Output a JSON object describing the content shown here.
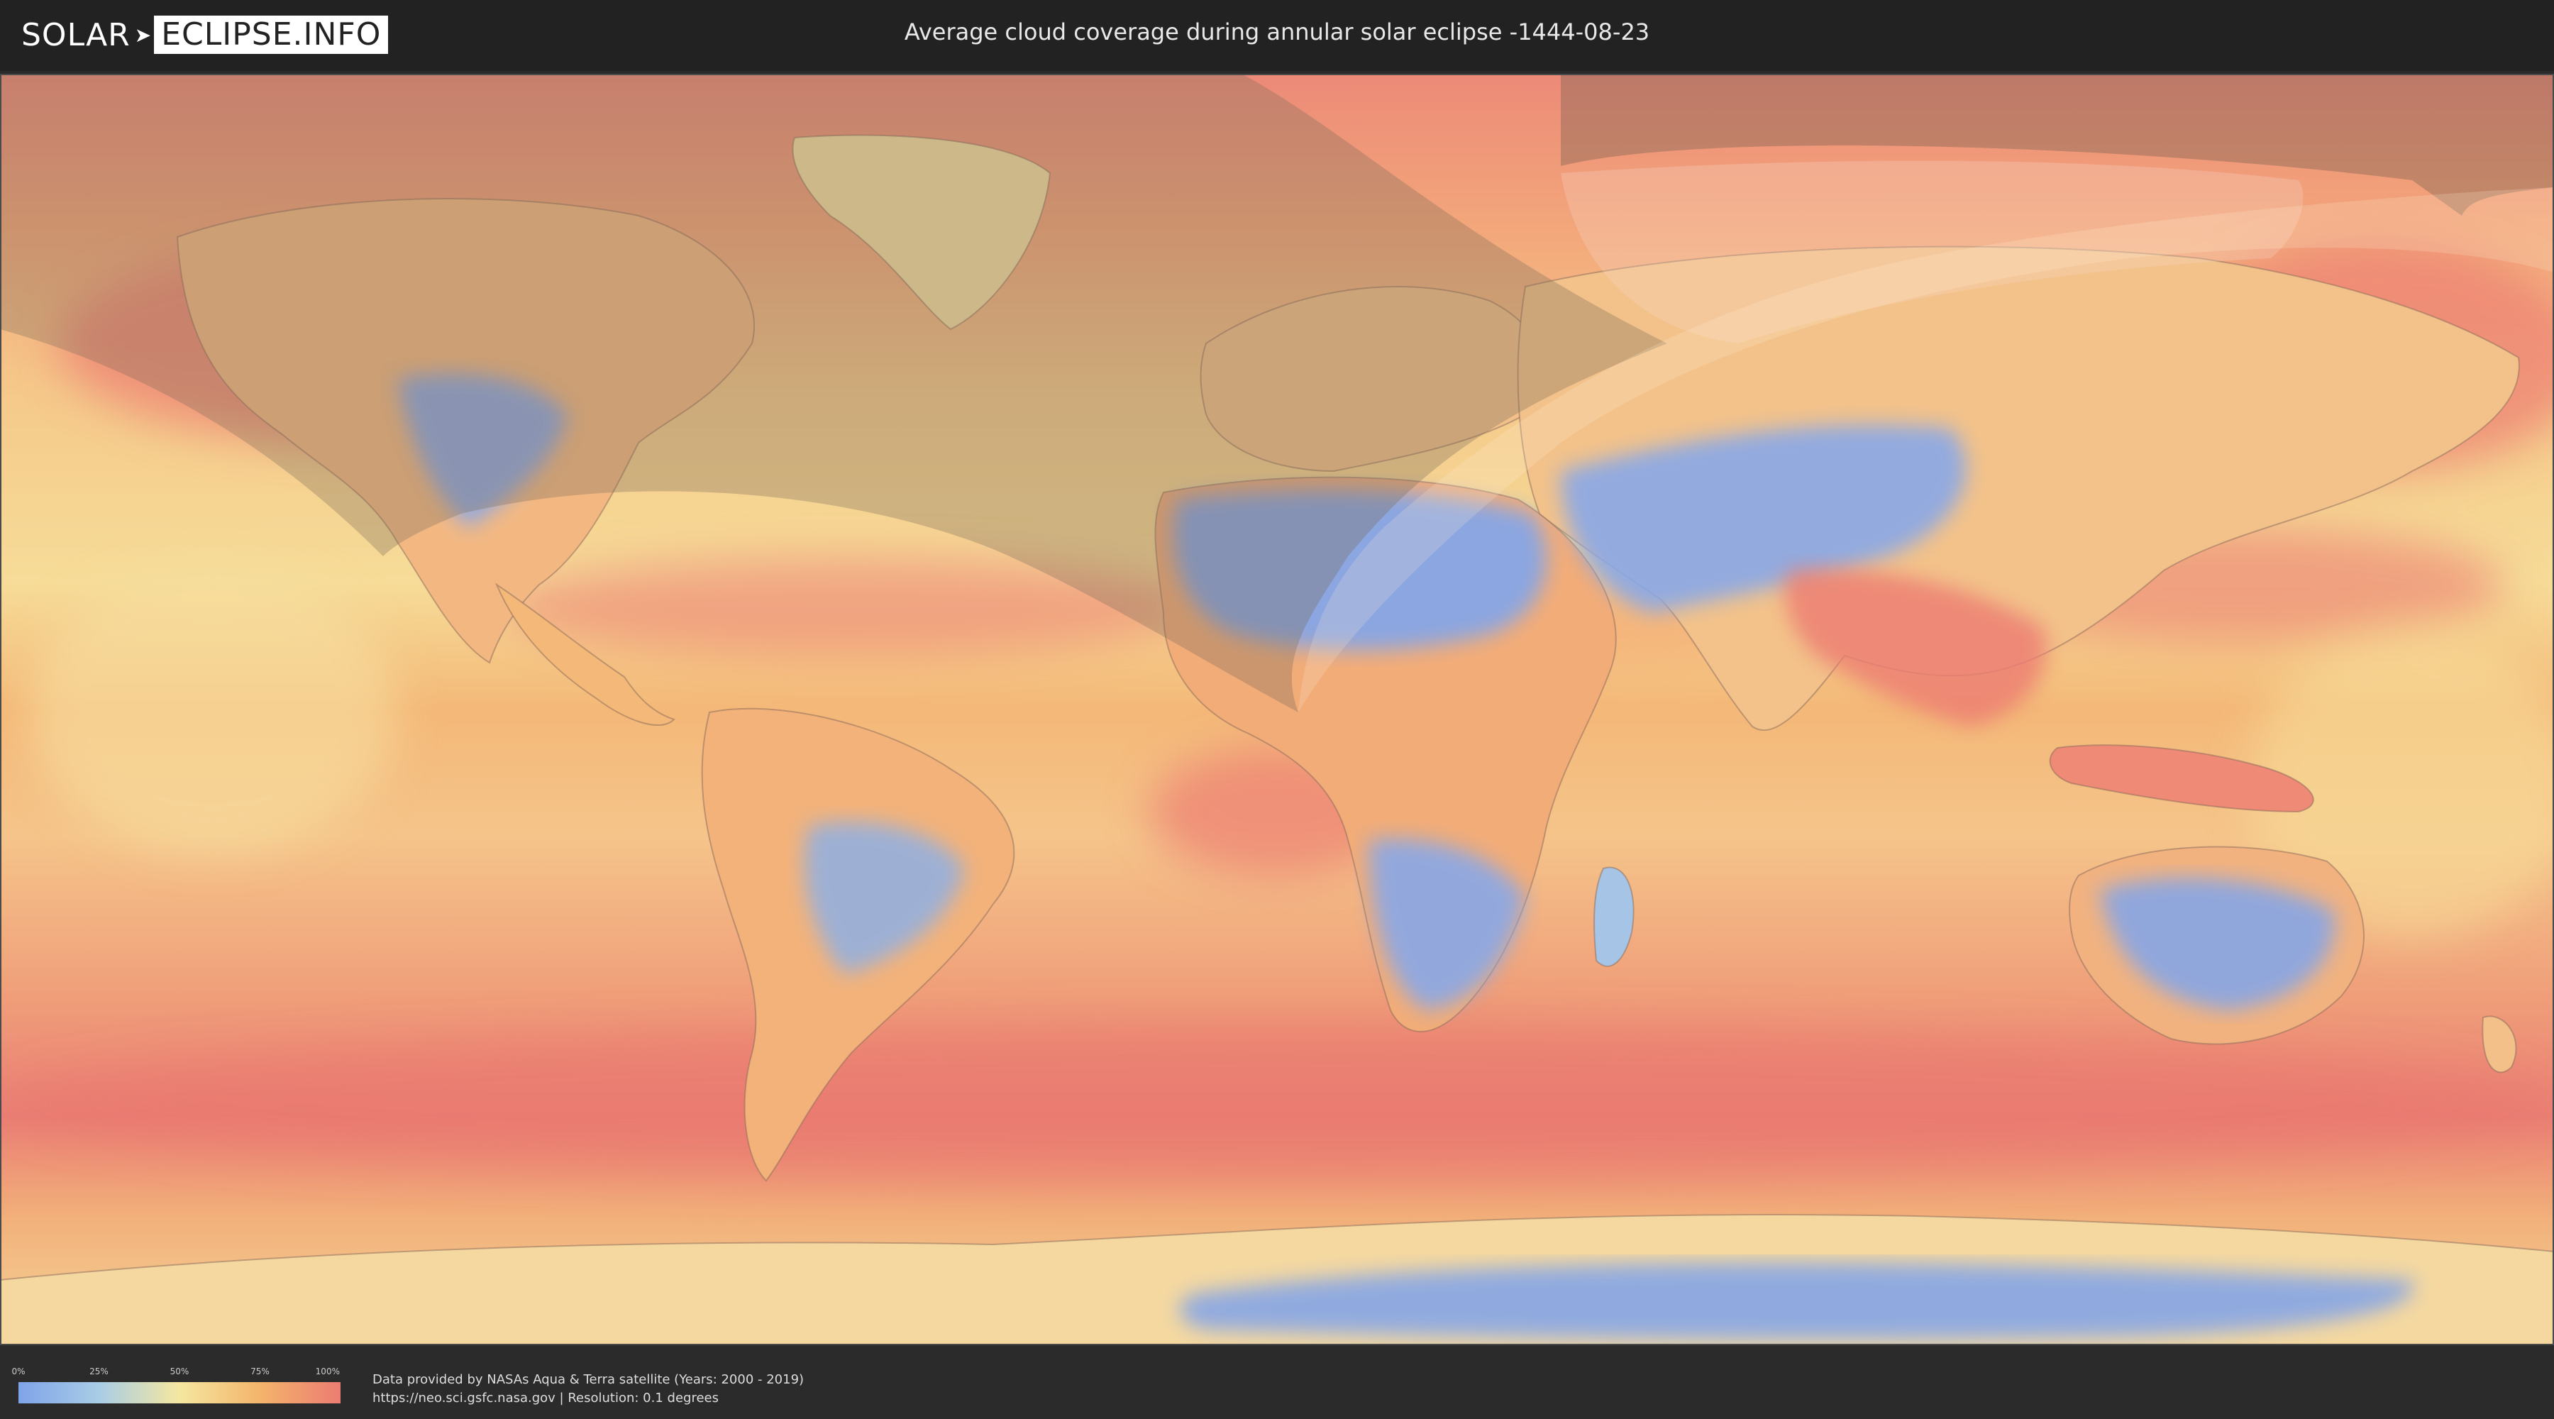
{
  "header": {
    "logo_left": "SOLAR",
    "logo_right": "ECLIPSE.INFO",
    "title": "Average cloud coverage during annular solar eclipse -1444-08-23"
  },
  "legend": {
    "ticks": [
      "0%",
      "25%",
      "50%",
      "75%",
      "100%"
    ],
    "colors": [
      "#7fa3e8",
      "#a9cde6",
      "#f5e7a0",
      "#f4b46b",
      "#ec7c72"
    ]
  },
  "credits": {
    "line1": "Data provided by NASAs Aqua & Terra satellite (Years: 2000 - 2019)",
    "line2": "https://neo.sci.gsfc.nasa.gov | Resolution: 0.1 degrees"
  },
  "map": {
    "colors": {
      "clear": "#7fa3e8",
      "light": "#a9cde6",
      "medium": "#f5e7a0",
      "heavy": "#f4b46b",
      "overcast": "#ec7c72",
      "land_outline": "#8a6a5a",
      "shadow": "#6b5a4a"
    }
  }
}
